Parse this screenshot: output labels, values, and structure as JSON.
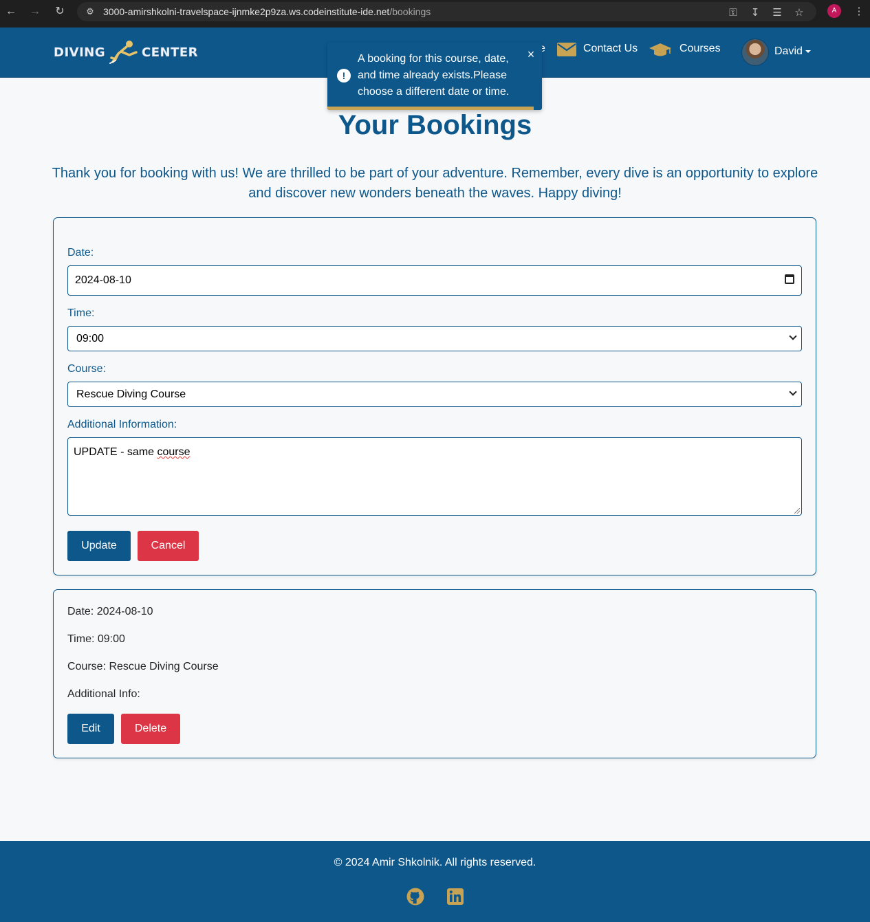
{
  "browser": {
    "url_host": "3000-amirshkolni-travelspace-ijnmke2p9za.ws.codeinstitute-ide.net",
    "url_path": "/bookings",
    "profile_initial": "A"
  },
  "navbar": {
    "logo_left": "DIVING",
    "logo_right": "CENTER",
    "partial_link_fragment": "e",
    "contact_label": "Contact Us",
    "courses_label": "Courses",
    "user_name": "David"
  },
  "toast": {
    "message": "A booking for this course, date, and time already exists.Please choose a different date or time.",
    "close_symbol": "×",
    "icon_symbol": "!"
  },
  "page": {
    "title": "Your Bookings",
    "intro": "Thank you for booking with us! We are thrilled to be part of your adventure. Remember, every dive is an opportunity to explore and discover new wonders beneath the waves. Happy diving!"
  },
  "form": {
    "date_label": "Date:",
    "date_value": "2024-08-10",
    "time_label": "Time:",
    "time_value": "09:00",
    "course_label": "Course:",
    "course_value": "Rescue Diving Course",
    "info_label": "Additional Information:",
    "info_value_prefix": "UPDATE - same ",
    "info_value_misspelled": "course",
    "update_button": "Update",
    "cancel_button": "Cancel"
  },
  "booking": {
    "date": "Date: 2024-08-10",
    "time": "Time: 09:00",
    "course": "Course: Rescue Diving Course",
    "additional_info": "Additional Info:",
    "edit_button": "Edit",
    "delete_button": "Delete"
  },
  "footer": {
    "copyright": "© 2024 Amir Shkolnik. All rights reserved.",
    "icons": [
      "github-icon",
      "linkedin-icon"
    ]
  },
  "colors": {
    "brand_blue": "#0d578b",
    "gold_accent": "#c9a354",
    "danger_red": "#dc3545",
    "page_bg": "#f7f8f9"
  }
}
